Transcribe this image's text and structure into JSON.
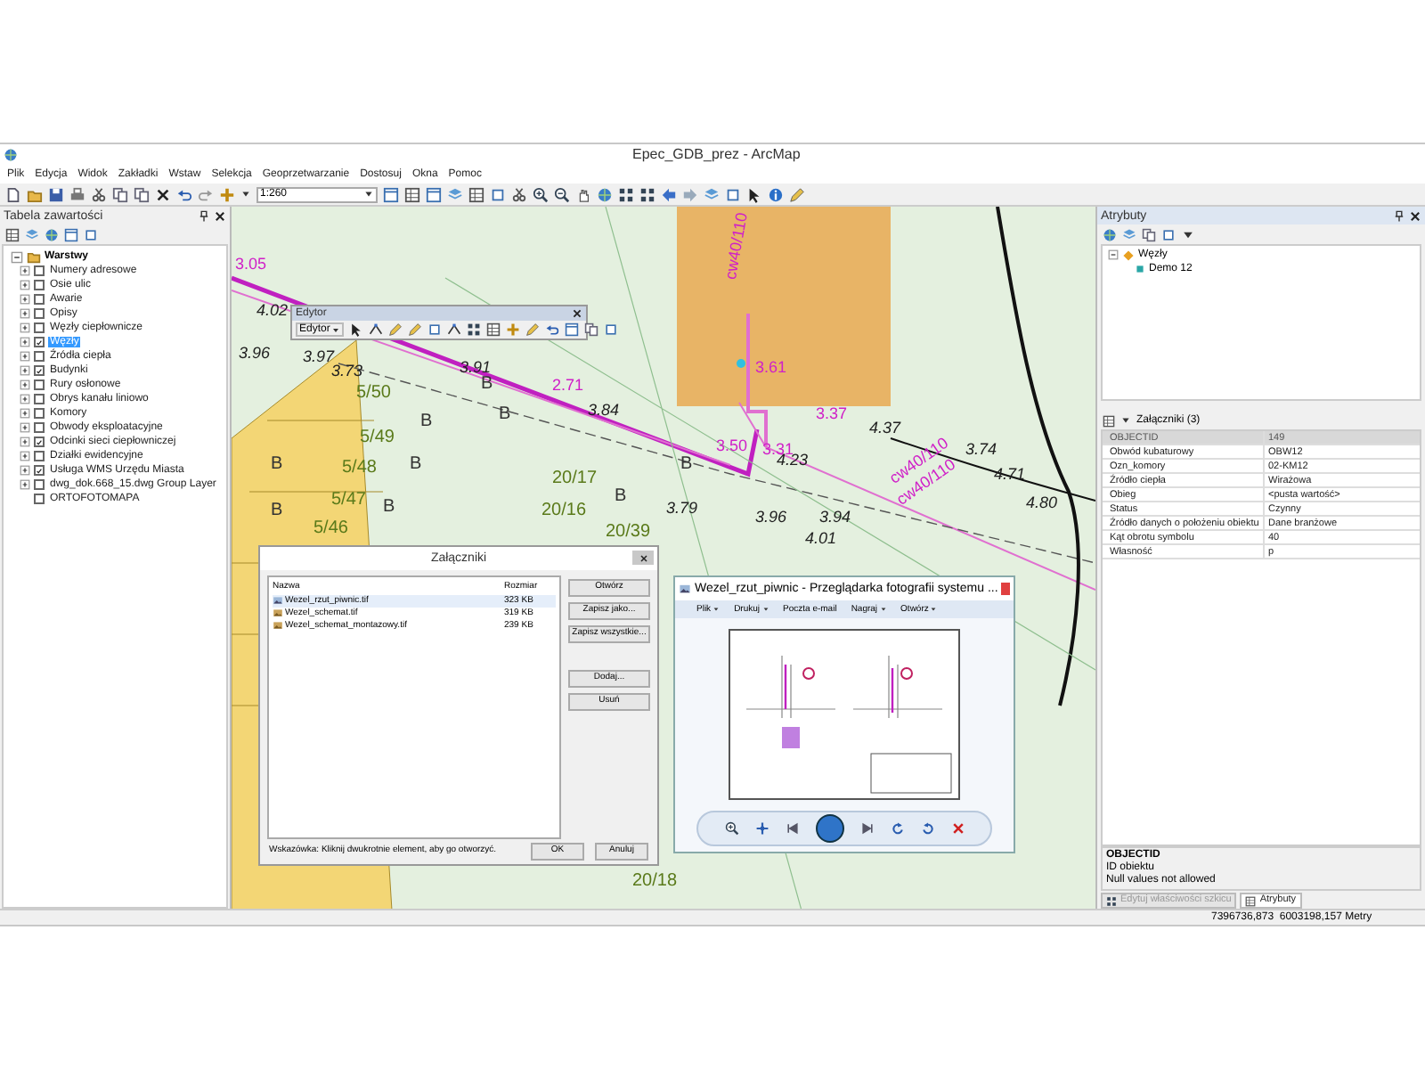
{
  "window": {
    "title": "Epec_GDB_prez - ArcMap"
  },
  "menu": [
    "Plik",
    "Edycja",
    "Widok",
    "Zakładki",
    "Wstaw",
    "Selekcja",
    "Geoprzetwarzanie",
    "Dostosuj",
    "Okna",
    "Pomoc"
  ],
  "toolbar": {
    "scale": "1:260"
  },
  "toc": {
    "title": "Tabela zawartości",
    "root": {
      "label": "Warstwy",
      "expanded": true
    },
    "layers": [
      {
        "label": "Numery adresowe",
        "checked": false,
        "selected": false,
        "expandable": true
      },
      {
        "label": "Osie ulic",
        "checked": false,
        "selected": false,
        "expandable": true
      },
      {
        "label": "Awarie",
        "checked": false,
        "selected": false,
        "expandable": true
      },
      {
        "label": "Opisy",
        "checked": false,
        "selected": false,
        "expandable": true
      },
      {
        "label": "Węzły ciepłownicze",
        "checked": false,
        "selected": false,
        "expandable": true
      },
      {
        "label": "Węzły",
        "checked": true,
        "selected": true,
        "expandable": true
      },
      {
        "label": "Źródła ciepła",
        "checked": false,
        "selected": false,
        "expandable": true
      },
      {
        "label": "Budynki",
        "checked": true,
        "selected": false,
        "expandable": true
      },
      {
        "label": "Rury osłonowe",
        "checked": false,
        "selected": false,
        "expandable": true
      },
      {
        "label": "Obrys kanału liniowo",
        "checked": false,
        "selected": false,
        "expandable": true
      },
      {
        "label": "Komory",
        "checked": false,
        "selected": false,
        "expandable": true
      },
      {
        "label": "Obwody eksploatacyjne",
        "checked": false,
        "selected": false,
        "expandable": true
      },
      {
        "label": "Odcinki sieci ciepłowniczej",
        "checked": true,
        "selected": false,
        "expandable": true
      },
      {
        "label": "Działki ewidencyjne",
        "checked": false,
        "selected": false,
        "expandable": true
      },
      {
        "label": "Usługa WMS Urzędu Miasta",
        "checked": true,
        "selected": false,
        "expandable": true
      },
      {
        "label": "dwg_dok.668_15.dwg Group Layer",
        "checked": false,
        "selected": false,
        "expandable": true
      },
      {
        "label": "ORTOFOTOMAPA",
        "checked": false,
        "selected": false,
        "expandable": false
      }
    ]
  },
  "map": {
    "labels": [
      {
        "text": "3.05",
        "kind": "pipe"
      },
      {
        "text": "4.02",
        "kind": "elevation"
      },
      {
        "text": "3.96",
        "kind": "elevation"
      },
      {
        "text": "3.97",
        "kind": "elevation"
      },
      {
        "text": "3.73",
        "kind": "elevation"
      },
      {
        "text": "3.91",
        "kind": "elevation"
      },
      {
        "text": "2.71",
        "kind": "pipe"
      },
      {
        "text": "3.84",
        "kind": "elevation"
      },
      {
        "text": "3.61",
        "kind": "pipe"
      },
      {
        "text": "3.37",
        "kind": "pipe"
      },
      {
        "text": "3.50",
        "kind": "pipe"
      },
      {
        "text": "3.31",
        "kind": "pipe"
      },
      {
        "text": "4.23",
        "kind": "elevation"
      },
      {
        "text": "4.37",
        "kind": "elevation"
      },
      {
        "text": "3.74",
        "kind": "elevation"
      },
      {
        "text": "4.71",
        "kind": "elevation"
      },
      {
        "text": "4.80",
        "kind": "elevation"
      },
      {
        "text": "3.79",
        "kind": "elevation"
      },
      {
        "text": "3.96",
        "kind": "elevation"
      },
      {
        "text": "3.94",
        "kind": "elevation"
      },
      {
        "text": "4.01",
        "kind": "elevation"
      },
      {
        "text": "5/50",
        "kind": "parcel"
      },
      {
        "text": "5/49",
        "kind": "parcel"
      },
      {
        "text": "5/48",
        "kind": "parcel"
      },
      {
        "text": "5/47",
        "kind": "parcel"
      },
      {
        "text": "5/46",
        "kind": "parcel"
      },
      {
        "text": "20/17",
        "kind": "parcel"
      },
      {
        "text": "20/16",
        "kind": "parcel"
      },
      {
        "text": "20/39",
        "kind": "parcel"
      },
      {
        "text": "20/18",
        "kind": "parcel"
      },
      {
        "text": "cw40/110",
        "kind": "pipe"
      },
      {
        "text": "cw40/110",
        "kind": "pipe"
      },
      {
        "text": "cw40/110",
        "kind": "pipe"
      },
      {
        "text": "B",
        "kind": "symbol"
      },
      {
        "text": "B",
        "kind": "symbol"
      },
      {
        "text": "B",
        "kind": "symbol"
      },
      {
        "text": "B",
        "kind": "symbol"
      },
      {
        "text": "B",
        "kind": "symbol"
      },
      {
        "text": "B",
        "kind": "symbol"
      },
      {
        "text": "B",
        "kind": "symbol"
      },
      {
        "text": "B",
        "kind": "symbol"
      },
      {
        "text": "B",
        "kind": "symbol"
      }
    ]
  },
  "editor_toolbar": {
    "title": "Edytor",
    "menu_button": "Edytor"
  },
  "attachments_dialog": {
    "title": "Załączniki",
    "columns": [
      "Nazwa",
      "Rozmiar"
    ],
    "files": [
      {
        "name": "Wezel_rzut_piwnic.tif",
        "size": "323 KB",
        "selected": true
      },
      {
        "name": "Wezel_schemat.tif",
        "size": "319 KB",
        "selected": false
      },
      {
        "name": "Wezel_schemat_montazowy.tif",
        "size": "239 KB",
        "selected": false
      }
    ],
    "side_buttons": [
      "Otwórz",
      "Zapisz jako...",
      "Zapisz wszystkie...",
      "Dodaj...",
      "Usuń"
    ],
    "hint": "Wskazówka: Kliknij dwukrotnie element, aby go otworzyć.",
    "buttons": [
      "OK",
      "Anuluj"
    ]
  },
  "photo_viewer": {
    "title": "Wezel_rzut_piwnic - Przeglądarka fotografii systemu ...",
    "menu": [
      {
        "label": "Plik",
        "dropdown": true
      },
      {
        "label": "Drukuj",
        "dropdown": true
      },
      {
        "label": "Poczta e-mail",
        "dropdown": false
      },
      {
        "label": "Nagraj",
        "dropdown": true
      },
      {
        "label": "Otwórz",
        "dropdown": true
      }
    ]
  },
  "attributes": {
    "title": "Atrybuty",
    "tree": {
      "layer": "Węzły",
      "feature": "Demo 12"
    },
    "attachments_label": "Załączniki (3)",
    "rows": [
      {
        "field": "OBJECTID",
        "value": "149",
        "disabled": true
      },
      {
        "field": "Obwód kubaturowy",
        "value": "OBW12",
        "disabled": false
      },
      {
        "field": "Ozn_komory",
        "value": "02-KM12",
        "disabled": false
      },
      {
        "field": "Źródło ciepła",
        "value": "Wirażowa",
        "disabled": false
      },
      {
        "field": "Obieg",
        "value": "<pusta wartość>",
        "disabled": false
      },
      {
        "field": "Status",
        "value": "Czynny",
        "disabled": false
      },
      {
        "field": "Źródło danych o położeniu obiektu",
        "value": "Dane branżowe",
        "disabled": false
      },
      {
        "field": "Kąt obrotu symbolu",
        "value": "40",
        "disabled": false
      },
      {
        "field": "Własność",
        "value": "p",
        "disabled": false
      }
    ],
    "description": {
      "field": "OBJECTID",
      "alias": "ID obiektu",
      "note": "Null values not allowed"
    },
    "tabs": [
      {
        "label": "Edytuj właściwości szkicu",
        "selected": false
      },
      {
        "label": "Atrybuty",
        "selected": true
      }
    ]
  },
  "status_bar": {
    "coordinates": "7396736,873  6003198,157 Metry"
  }
}
